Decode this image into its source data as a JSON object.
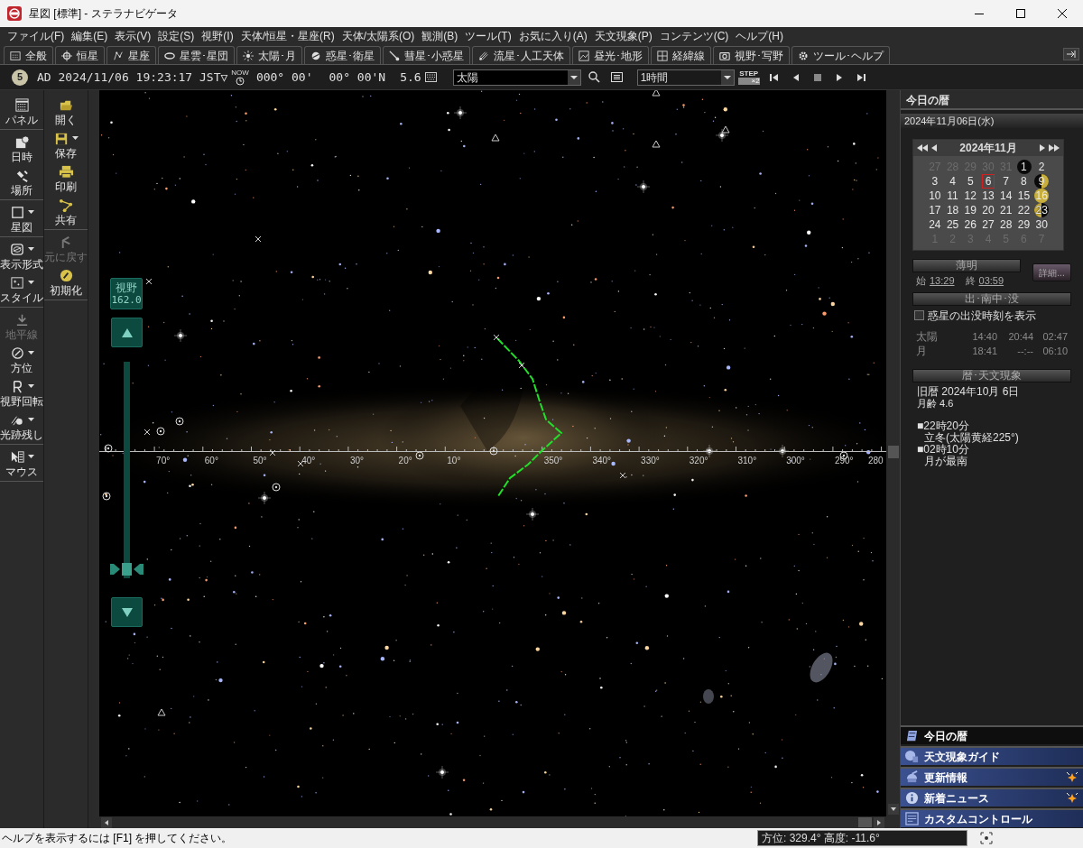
{
  "window": {
    "title": "星図 [標準] - ステラナビゲータ"
  },
  "menu": [
    "ファイル(F)",
    "編集(E)",
    "表示(V)",
    "設定(S)",
    "視野(I)",
    "天体/恒星・星座(R)",
    "天体/太陽系(O)",
    "観測(B)",
    "ツール(T)",
    "お気に入り(A)",
    "天文現象(P)",
    "コンテンツ(C)",
    "ヘルプ(H)"
  ],
  "tabs": [
    "全般",
    "恒星",
    "星座",
    "星雲･星団",
    "太陽･月",
    "惑星･衛星",
    "彗星･小惑星",
    "流星･人工天体",
    "昼光･地形",
    "経緯線",
    "視野･写野",
    "ツール･ヘルプ"
  ],
  "control_bar": {
    "moon_age": "5",
    "datetime": "AD 2024/11/06 19:23:17 JST▽",
    "now_label": "NOW",
    "azimuth": "000° 00'",
    "altitude": "00° 00'N",
    "magnitude": "5.6",
    "target": "太陽",
    "step_interval": "1時間",
    "step_label": "STEP",
    "step_multiplier": "×2"
  },
  "left_toolbar": {
    "column_1": [
      {
        "items": [
          {
            "label": "パネル",
            "dropdown": false,
            "disabled": false
          }
        ]
      },
      {
        "items": [
          {
            "label": "日時",
            "dropdown": false,
            "disabled": false
          },
          {
            "label": "場所",
            "dropdown": false,
            "disabled": false
          }
        ]
      },
      {
        "items": [
          {
            "label": "星図",
            "dropdown": true,
            "disabled": false
          }
        ]
      },
      {
        "items": [
          {
            "label": "表示形式",
            "dropdown": true,
            "disabled": false
          },
          {
            "label": "スタイル",
            "dropdown": true,
            "disabled": false
          }
        ]
      },
      {
        "items": [
          {
            "label": "地平線",
            "dropdown": false,
            "disabled": true
          },
          {
            "label": "方位",
            "dropdown": true,
            "disabled": false
          },
          {
            "label": "視野回転",
            "dropdown": true,
            "disabled": false
          },
          {
            "label": "光跡残し",
            "dropdown": true,
            "disabled": false
          }
        ]
      },
      {
        "items": [
          {
            "label": "マウス",
            "dropdown": true,
            "disabled": false
          }
        ]
      }
    ],
    "column_2": [
      {
        "items": [
          {
            "label": "開く",
            "dropdown": false,
            "disabled": false
          },
          {
            "label": "保存",
            "dropdown": true,
            "disabled": false
          },
          {
            "label": "印刷",
            "dropdown": false,
            "disabled": false
          },
          {
            "label": "共有",
            "dropdown": false,
            "disabled": false
          }
        ]
      },
      {
        "items": [
          {
            "label": "元に戻す",
            "dropdown": false,
            "disabled": true
          },
          {
            "label": "初期化",
            "dropdown": false,
            "disabled": false
          }
        ]
      }
    ]
  },
  "fov": {
    "label": "視野",
    "value": "162.0",
    "level": 0.04
  },
  "sky": {
    "horizon_labels": [
      "70°",
      "60°",
      "50°",
      "40°",
      "30°",
      "20°",
      "10°",
      "350°",
      "340°",
      "330°",
      "320°",
      "310°",
      "300°",
      "290°",
      "280"
    ]
  },
  "today_panel": {
    "title": "今日の暦",
    "date": "2024年11月06日(水)",
    "calendar": {
      "month": "2024年11月",
      "days": [
        {
          "day": "27",
          "kind": "other",
          "selected": false
        },
        {
          "day": "28",
          "kind": "other",
          "selected": false
        },
        {
          "day": "29",
          "kind": "other",
          "selected": false
        },
        {
          "day": "30",
          "kind": "other",
          "selected": false
        },
        {
          "day": "31",
          "kind": "other",
          "selected": false
        },
        {
          "day": "1",
          "kind": "new_moon",
          "selected": false
        },
        {
          "day": "2",
          "kind": "current",
          "selected": false
        },
        {
          "day": "3",
          "kind": "current",
          "selected": false
        },
        {
          "day": "4",
          "kind": "current",
          "selected": false
        },
        {
          "day": "5",
          "kind": "current",
          "selected": false
        },
        {
          "day": "6",
          "kind": "current",
          "selected": true
        },
        {
          "day": "7",
          "kind": "current",
          "selected": false
        },
        {
          "day": "8",
          "kind": "current",
          "selected": false
        },
        {
          "day": "9",
          "kind": "first_quarter",
          "selected": false
        },
        {
          "day": "10",
          "kind": "current",
          "selected": false
        },
        {
          "day": "11",
          "kind": "current",
          "selected": false
        },
        {
          "day": "12",
          "kind": "current",
          "selected": false
        },
        {
          "day": "13",
          "kind": "current",
          "selected": false
        },
        {
          "day": "14",
          "kind": "current",
          "selected": false
        },
        {
          "day": "15",
          "kind": "current",
          "selected": false
        },
        {
          "day": "16",
          "kind": "full_moon",
          "selected": false
        },
        {
          "day": "17",
          "kind": "current",
          "selected": false
        },
        {
          "day": "18",
          "kind": "current",
          "selected": false
        },
        {
          "day": "19",
          "kind": "current",
          "selected": false
        },
        {
          "day": "20",
          "kind": "current",
          "selected": false
        },
        {
          "day": "21",
          "kind": "current",
          "selected": false
        },
        {
          "day": "22",
          "kind": "current",
          "selected": false
        },
        {
          "day": "23",
          "kind": "last_quarter",
          "selected": false
        },
        {
          "day": "24",
          "kind": "current",
          "selected": false
        },
        {
          "day": "25",
          "kind": "current",
          "selected": false
        },
        {
          "day": "26",
          "kind": "current",
          "selected": false
        },
        {
          "day": "27",
          "kind": "current",
          "selected": false
        },
        {
          "day": "28",
          "kind": "current",
          "selected": false
        },
        {
          "day": "29",
          "kind": "current",
          "selected": false
        },
        {
          "day": "30",
          "kind": "current",
          "selected": false
        },
        {
          "day": "1",
          "kind": "other",
          "selected": false
        },
        {
          "day": "2",
          "kind": "other",
          "selected": false
        },
        {
          "day": "3",
          "kind": "other",
          "selected": false
        },
        {
          "day": "4",
          "kind": "other",
          "selected": false
        },
        {
          "day": "5",
          "kind": "other",
          "selected": false
        },
        {
          "day": "6",
          "kind": "other",
          "selected": false
        },
        {
          "day": "7",
          "kind": "other",
          "selected": false
        }
      ]
    },
    "twilight": {
      "title": "薄明",
      "start_label": "始",
      "start": "13:29",
      "end_label": "終",
      "end": "03:59",
      "details_button": "詳細..."
    },
    "rise_set": {
      "title": "出･南中･没",
      "checkbox": {
        "label": "惑星の出没時刻を表示",
        "checked": false
      },
      "rows": [
        {
          "name": "太陽",
          "rise": "14:40",
          "transit": "20:44",
          "set": "02:47"
        },
        {
          "name": "月",
          "rise": "18:41",
          "transit": "--:--",
          "set": "06:10"
        }
      ]
    },
    "almanac": {
      "title": "暦･天文現象",
      "lunar_date": "旧暦 2024年10月 6日",
      "moon_age": "月齢 4.6",
      "events": [
        {
          "time": "■22時20分",
          "text": "立冬(太陽黄経225°)"
        },
        {
          "time": "■02時10分",
          "text": "月が最南"
        }
      ]
    }
  },
  "panel_nav": [
    {
      "label": "今日の暦",
      "selected": true,
      "new": false
    },
    {
      "label": "天文現象ガイド",
      "selected": false,
      "new": false
    },
    {
      "label": "更新情報",
      "selected": false,
      "new": true
    },
    {
      "label": "新着ニュース",
      "selected": false,
      "new": true
    },
    {
      "label": "カスタムコントロール",
      "selected": false,
      "new": false
    }
  ],
  "status_bar": {
    "help": "ヘルプを表示するには [F1] を押してください。",
    "position": "方位: 329.4° 高度: -11.6°"
  }
}
